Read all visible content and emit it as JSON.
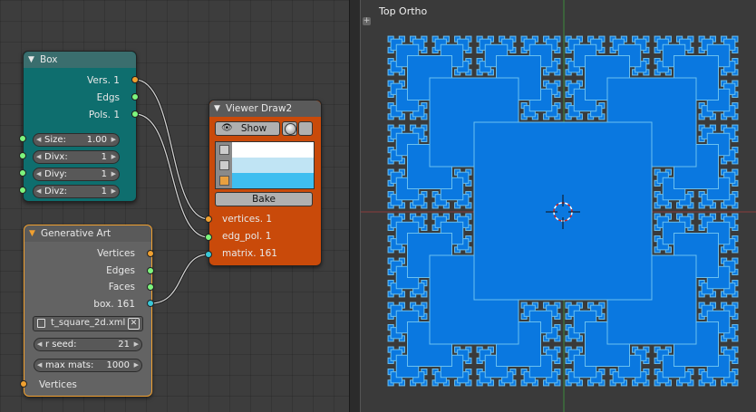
{
  "viewport": {
    "title": "Top Ortho"
  },
  "box_node": {
    "title": "Box",
    "outputs": [
      "Vers. 1",
      "Edgs",
      "Pols. 1"
    ],
    "fields": [
      {
        "label": "Size:",
        "value": "1.00"
      },
      {
        "label": "Divx:",
        "value": "1"
      },
      {
        "label": "Divy:",
        "value": "1"
      },
      {
        "label": "Divz:",
        "value": "1"
      }
    ]
  },
  "viewer_node": {
    "title": "Viewer Draw2",
    "show_label": "Show",
    "bake_label": "Bake",
    "inputs": [
      "vertices. 1",
      "edg_pol. 1",
      "matrix. 161"
    ],
    "color_swatches": [
      "#ffffff",
      "#c0e4f4",
      "#3fbef0"
    ]
  },
  "gen_node": {
    "title": "Generative Art",
    "outputs": [
      "Vertices",
      "Edges",
      "Faces",
      "box. 161"
    ],
    "file_name": "t_square_2d.xml",
    "fields": [
      {
        "label": "r seed:",
        "value": "21"
      },
      {
        "label": "max mats:",
        "value": "1000"
      }
    ],
    "input_label": "Vertices"
  },
  "colors": {
    "box_header": "#3a6e6e",
    "box_body": "#0e6e6e",
    "viewer_header": "#5a5a5a",
    "viewer_body": "#c94a0a",
    "gen_header": "#5a5a5a",
    "gen_body": "#636363",
    "fractal_fill": "#0a78e0",
    "fractal_edge": "#6ac0f0"
  }
}
